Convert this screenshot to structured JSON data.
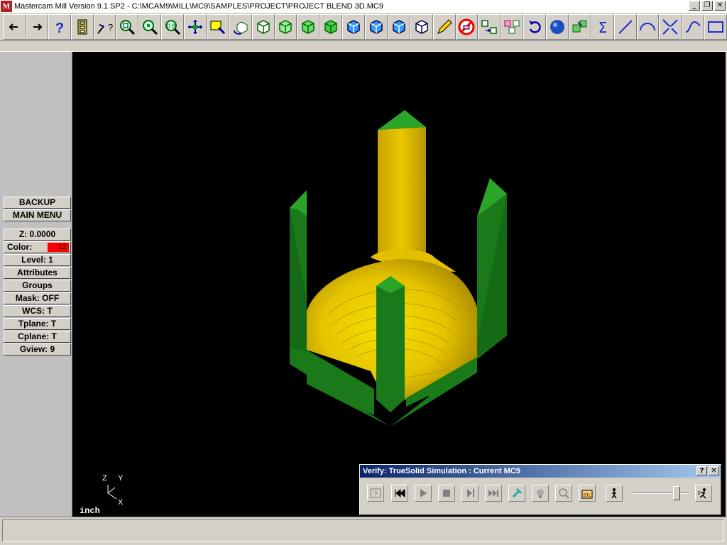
{
  "window": {
    "title": "Mastercam Mill Version 9.1 SP2 - C:\\MCAM9\\MILL\\MC9\\SAMPLES\\PROJECT\\PROJECT BLEND 3D.MC9",
    "app_icon": "mastercam-logo-icon",
    "controls": {
      "minimize": "_",
      "restore": "❐",
      "close": "✕"
    }
  },
  "toolbar": {
    "buttons": [
      {
        "name": "back-arrow",
        "icon": "arrow-left-icon"
      },
      {
        "name": "forward-arrow",
        "icon": "arrow-right-icon"
      },
      {
        "name": "help",
        "icon": "question-icon"
      },
      {
        "name": "file-cabinet",
        "icon": "cabinet-icon"
      },
      {
        "name": "analyze",
        "icon": "analyze-question-icon"
      },
      {
        "name": "zoom-window",
        "icon": "zoom-window-icon"
      },
      {
        "name": "unzoom",
        "icon": "unzoom-icon"
      },
      {
        "name": "zoom-fit",
        "icon": "zoom-fit-icon"
      },
      {
        "name": "pan",
        "icon": "pan-icon"
      },
      {
        "name": "select-screen",
        "icon": "select-icon"
      },
      {
        "name": "dynamic-rotate",
        "icon": "rotate-cube-icon"
      },
      {
        "name": "view-top",
        "icon": "cube-green-1-icon"
      },
      {
        "name": "view-front",
        "icon": "cube-green-2-icon"
      },
      {
        "name": "view-side",
        "icon": "cube-green-3-icon"
      },
      {
        "name": "view-iso",
        "icon": "cube-green-4-icon"
      },
      {
        "name": "cplane-top",
        "icon": "cube-blue-1-icon"
      },
      {
        "name": "cplane-front",
        "icon": "cube-blue-2-icon"
      },
      {
        "name": "cplane-side",
        "icon": "cube-blue-3-icon"
      },
      {
        "name": "cplane-3d",
        "icon": "cube-blue-4-icon"
      },
      {
        "name": "pencil",
        "icon": "pencil-icon"
      },
      {
        "name": "no-erase",
        "icon": "prohibit-eraser-icon"
      },
      {
        "name": "transform-translate",
        "icon": "translate-icon"
      },
      {
        "name": "transform-copy",
        "icon": "copy-transform-icon"
      },
      {
        "name": "undo",
        "icon": "undo-arc-icon"
      },
      {
        "name": "shading",
        "icon": "blue-sphere-icon"
      },
      {
        "name": "solids",
        "icon": "solids-boxes-icon"
      },
      {
        "name": "sum",
        "icon": "sigma-icon"
      },
      {
        "name": "line",
        "icon": "line-icon"
      },
      {
        "name": "arc",
        "icon": "arc-icon"
      },
      {
        "name": "fillet",
        "icon": "fillet-icon"
      },
      {
        "name": "spline",
        "icon": "spline-icon"
      },
      {
        "name": "rectangle",
        "icon": "rectangle-icon"
      }
    ]
  },
  "left_menu": {
    "backup": "BACKUP",
    "main_menu": "MAIN MENU",
    "z_depth": "Z:  0.0000",
    "color_label": "Color:",
    "color_value": "12",
    "color_swatch": "#ff0000",
    "level": "Level:  1",
    "attributes": "Attributes",
    "groups": "Groups",
    "mask": "Mask:  OFF",
    "wcs": "WCS:   T",
    "tplane": "Tplane:  T",
    "cplane": "Cplane:  T",
    "gview": "Gview:   9"
  },
  "viewport": {
    "background": "#000000",
    "axis_labels": {
      "z": "Z",
      "y": "Y",
      "x": "X"
    },
    "units": "inch",
    "colors": {
      "stock_green": "#1a7a1a",
      "stock_green_light": "#2aa52a",
      "part_yellow": "#e8c800",
      "part_gold": "#c9a400"
    }
  },
  "verify_dialog": {
    "title": "Verify: TrueSolid Simulation : Current MC9",
    "help": "?",
    "close": "✕",
    "buttons": [
      {
        "name": "options",
        "icon": "options-icon"
      },
      {
        "name": "rewind",
        "icon": "rewind-icon"
      },
      {
        "name": "play",
        "icon": "play-icon"
      },
      {
        "name": "stop",
        "icon": "stop-icon"
      },
      {
        "name": "step",
        "icon": "step-icon"
      },
      {
        "name": "fast-forward",
        "icon": "fast-forward-icon"
      },
      {
        "name": "tool-display",
        "icon": "tool-display-icon"
      },
      {
        "name": "light",
        "icon": "lightbulb-icon"
      },
      {
        "name": "zoom",
        "icon": "magnify-icon"
      },
      {
        "name": "save-stl",
        "icon": "stl-icon"
      }
    ],
    "slow_icon": "walk-icon",
    "fast_icon": "run-icon",
    "speed": 0.82
  },
  "status_bar": {
    "text": ""
  }
}
